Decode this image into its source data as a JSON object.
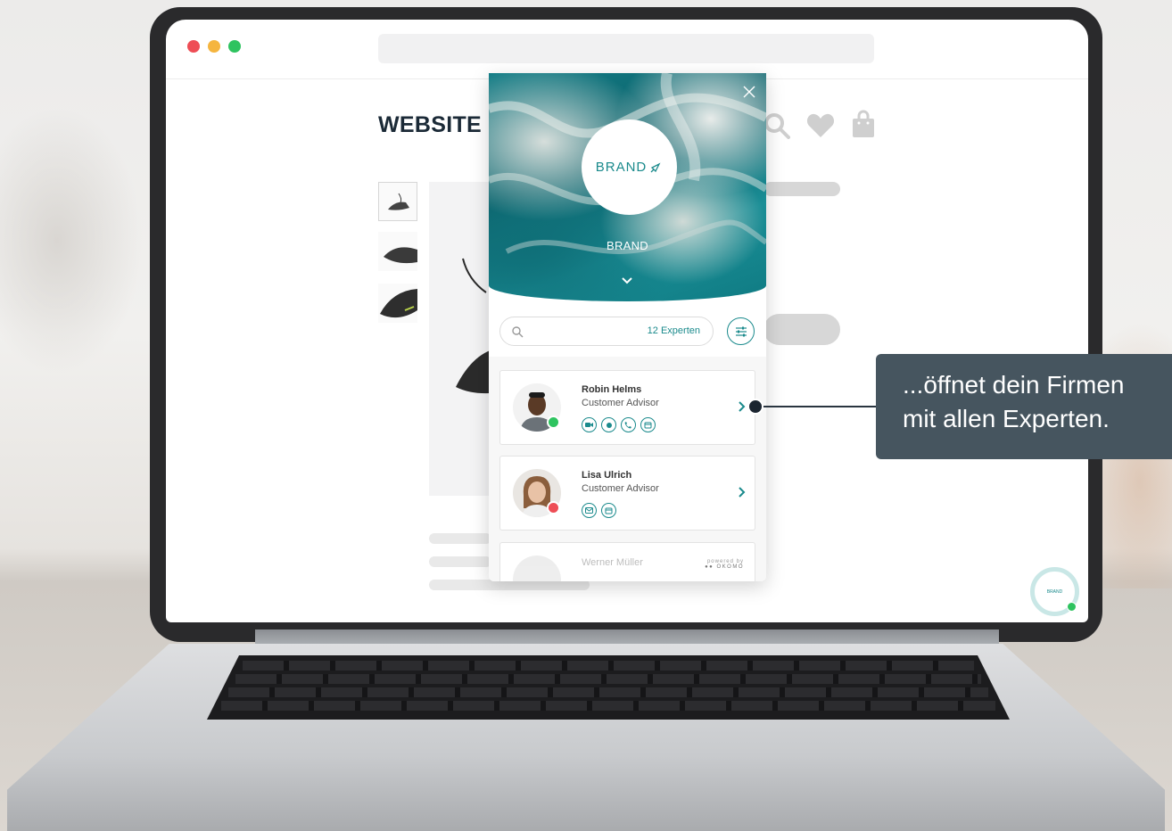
{
  "website": {
    "title": "WEBSITE"
  },
  "widget": {
    "brand_logo": "BRAND",
    "brand_name": "BRAND",
    "search_placeholder": "",
    "expert_count": "12 Experten",
    "experts": [
      {
        "name": "Robin Helms",
        "role": "Customer Advisor",
        "status": "online",
        "status_color": "#2ec35f",
        "channels": [
          "video-icon",
          "chat-icon",
          "phone-icon",
          "calendar-icon"
        ]
      },
      {
        "name": "Lisa Ulrich",
        "role": "Customer Advisor",
        "status": "offline",
        "status_color": "#ee4d55",
        "channels": [
          "email-icon",
          "calendar-icon"
        ]
      },
      {
        "name": "Werner Müller",
        "role": "",
        "status": "",
        "channels": []
      }
    ],
    "powered_by": "powered by",
    "powered_brand": "OKOMO"
  },
  "callout": {
    "line1": "...öffnet dein Firmen",
    "line2": "mit allen Experten."
  },
  "launcher": {
    "label": "BRAND"
  },
  "colors": {
    "accent": "#1a8a8c",
    "online": "#2ec35f",
    "offline": "#ee4d55",
    "callout_bg": "#46555f"
  }
}
